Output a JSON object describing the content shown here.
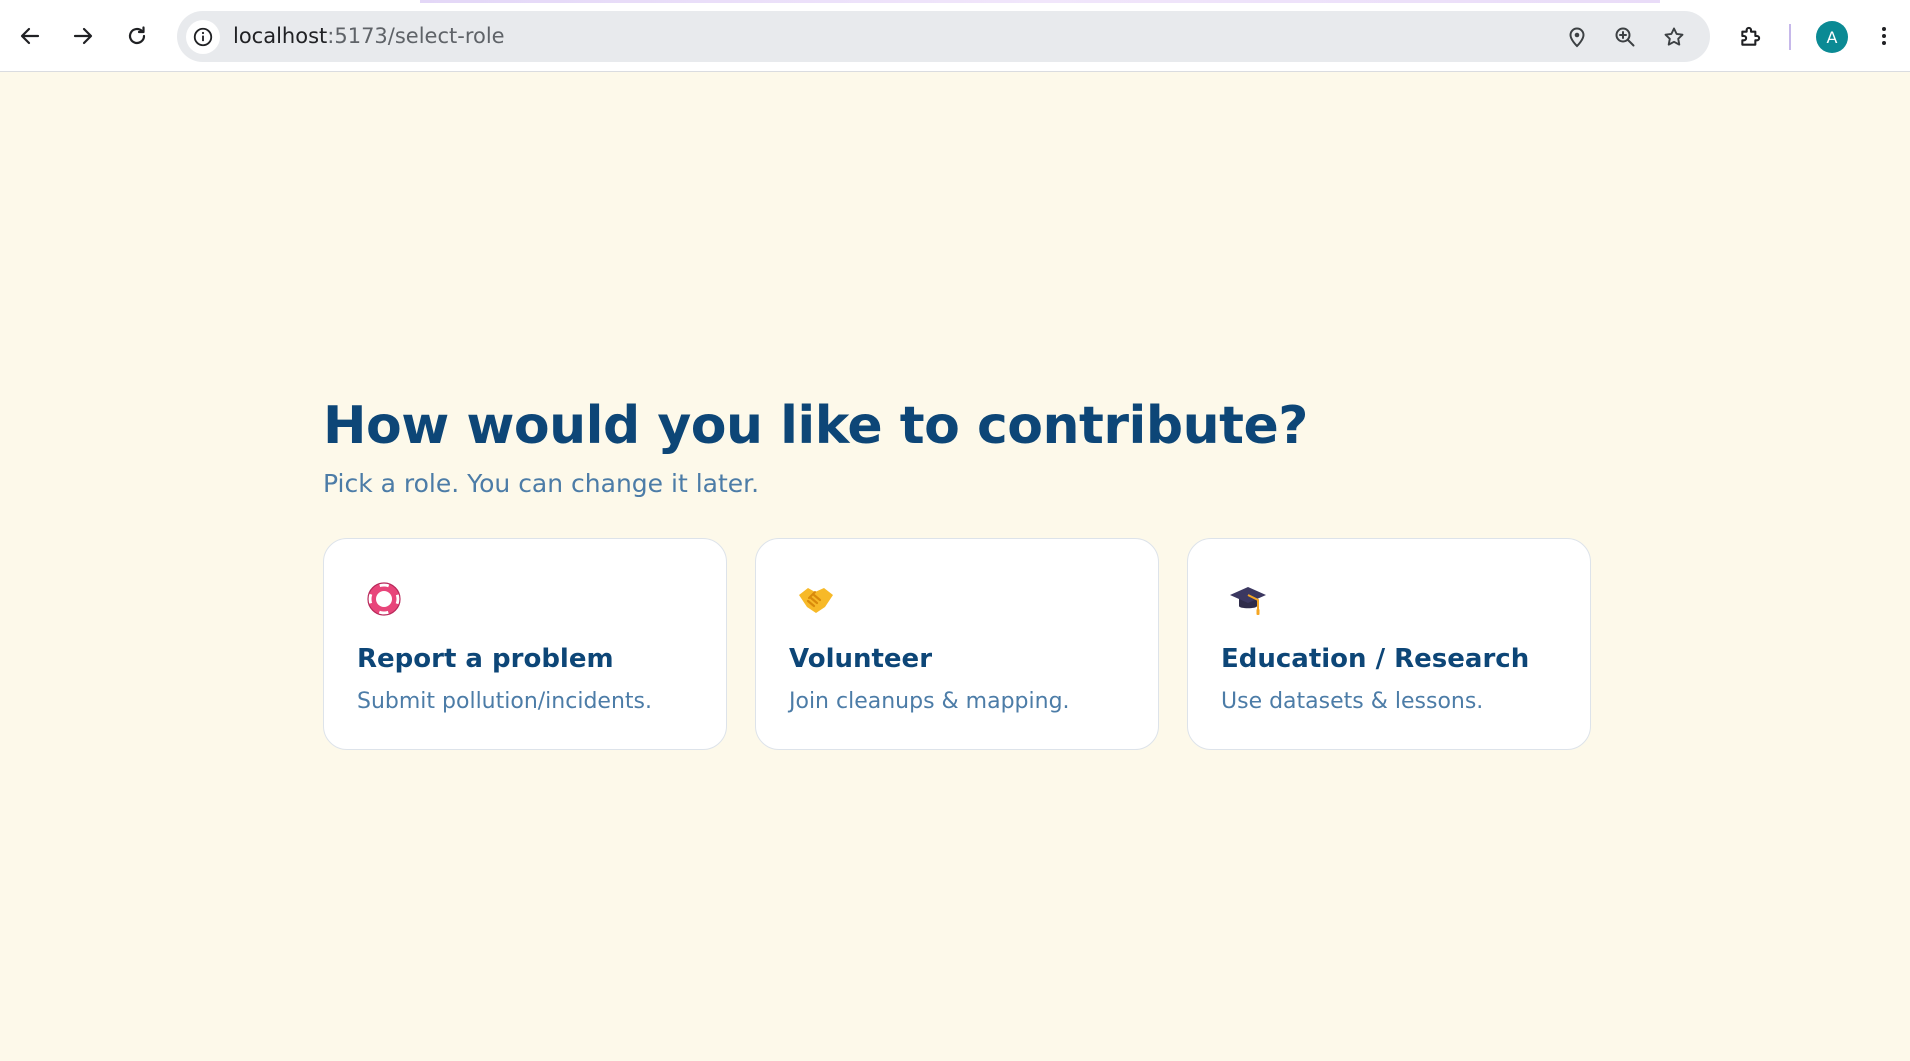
{
  "browser": {
    "url_host": "localhost",
    "url_path": ":5173/select-role",
    "profile_initial": "A"
  },
  "icons": {
    "back": "arrow-left-icon",
    "forward": "arrow-right-icon",
    "reload": "reload-icon",
    "site_info": "info-icon",
    "location": "location-pin-icon",
    "zoom": "zoom-in-icon",
    "bookmark": "star-icon",
    "extensions": "puzzle-icon",
    "menu": "more-vertical-icon"
  },
  "main": {
    "title": "How would you like to contribute?",
    "subtitle": "Pick a role. You can change it later."
  },
  "roles": [
    {
      "title": "Report a problem",
      "description": "Submit pollution/incidents.",
      "icon": "lifebuoy-icon"
    },
    {
      "title": "Volunteer",
      "description": "Join cleanups & mapping.",
      "icon": "handshake-icon"
    },
    {
      "title": "Education / Research",
      "description": "Use datasets & lessons.",
      "icon": "graduation-cap-icon"
    }
  ],
  "colors": {
    "background": "#fdf9ea",
    "heading": "#0d4677",
    "muted_text": "#4c7ca7",
    "card": "#ffffff",
    "avatar": "#0b8a94"
  }
}
